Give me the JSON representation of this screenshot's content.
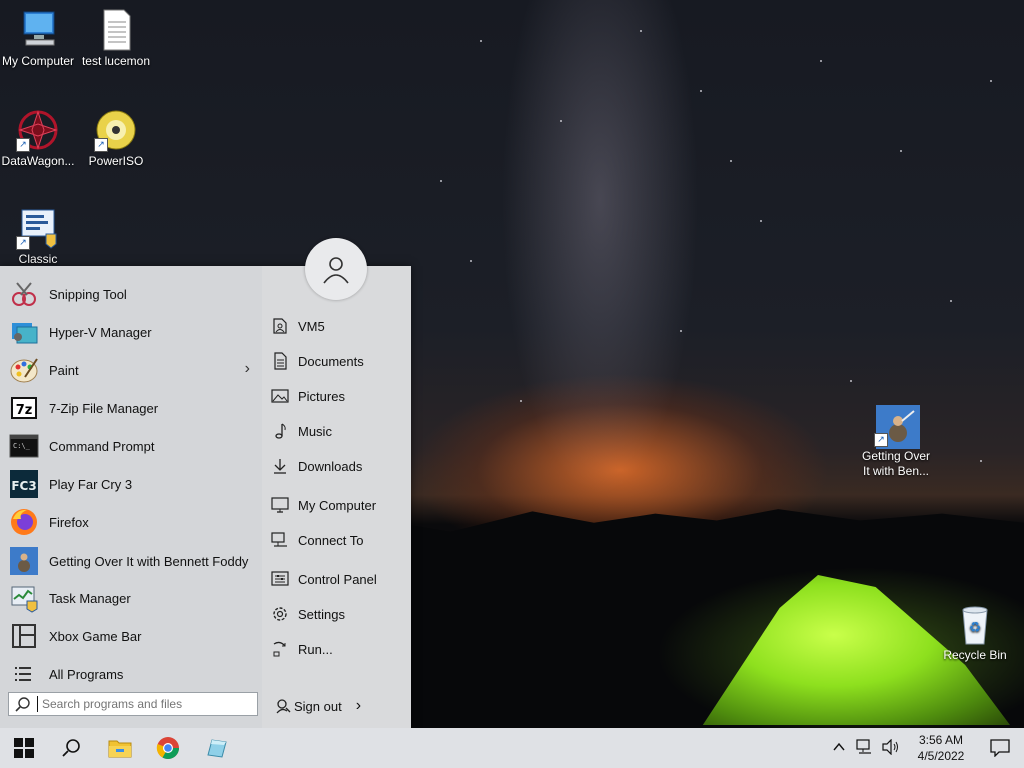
{
  "desktop": {
    "icons": [
      {
        "label": "My Computer",
        "icon": "computer-icon"
      },
      {
        "label": "test lucemon",
        "icon": "document-icon"
      },
      {
        "label": "DataWagon...",
        "icon": "datawagon-icon"
      },
      {
        "label": "PowerISO",
        "icon": "disc-icon"
      },
      {
        "label": "Classic",
        "icon": "classic-shell-icon"
      },
      {
        "label": "Getting Over It with Ben...",
        "icon": "getting-over-it-icon"
      },
      {
        "label": "Recycle Bin",
        "icon": "recycle-bin-icon"
      }
    ]
  },
  "start_menu": {
    "programs": [
      {
        "label": "Snipping Tool",
        "icon": "scissors-icon"
      },
      {
        "label": "Hyper-V Manager",
        "icon": "hyperv-icon"
      },
      {
        "label": "Paint",
        "icon": "palette-icon",
        "has_submenu": true
      },
      {
        "label": "7-Zip File Manager",
        "icon": "7zip-icon"
      },
      {
        "label": "Command Prompt",
        "icon": "terminal-icon"
      },
      {
        "label": "Play Far Cry 3",
        "icon": "farcry3-icon"
      },
      {
        "label": "Firefox",
        "icon": "firefox-icon"
      },
      {
        "label": "Getting Over It with Bennett Foddy",
        "icon": "getting-over-it-icon"
      },
      {
        "label": "Task Manager",
        "icon": "task-manager-icon"
      },
      {
        "label": "Xbox Game Bar",
        "icon": "xbox-icon"
      },
      {
        "label": "All Programs",
        "icon": "list-icon"
      }
    ],
    "places": [
      {
        "label": "VM5",
        "icon": "user-folder-icon"
      },
      {
        "label": "Documents",
        "icon": "document-icon"
      },
      {
        "label": "Pictures",
        "icon": "picture-icon"
      },
      {
        "label": "Music",
        "icon": "music-icon"
      },
      {
        "label": "Downloads",
        "icon": "download-icon"
      },
      {
        "label": "My Computer",
        "icon": "monitor-icon"
      },
      {
        "label": "Connect To",
        "icon": "network-icon"
      },
      {
        "label": "Control Panel",
        "icon": "control-panel-icon"
      },
      {
        "label": "Settings",
        "icon": "gear-icon"
      },
      {
        "label": "Run...",
        "icon": "run-icon"
      }
    ],
    "search_placeholder": "Search programs and files",
    "sign_out_label": "Sign out"
  },
  "taskbar": {
    "apps": [
      "start-icon",
      "search-icon",
      "file-explorer-icon",
      "chrome-icon",
      "classic-shell-icon"
    ],
    "clock_time": "3:56 AM",
    "clock_date": "4/5/2022"
  }
}
